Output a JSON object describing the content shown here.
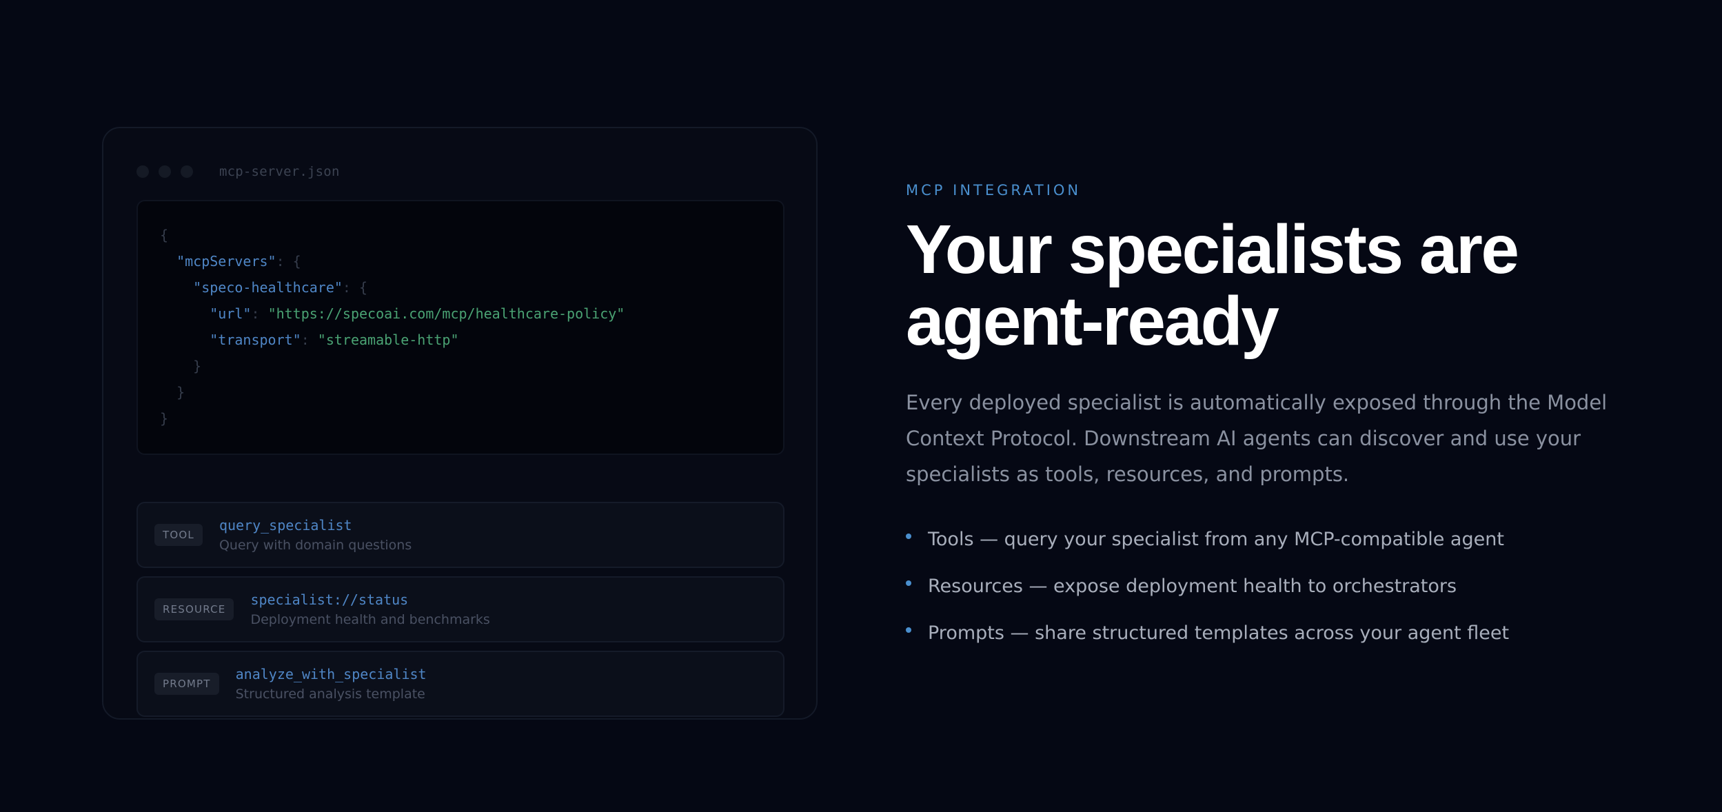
{
  "code_panel": {
    "filename": "mcp-server.json",
    "lines": [
      {
        "p0": "{",
        "k": "",
        "p1": "",
        "v": "",
        "p2": ""
      },
      {
        "p0": "  ",
        "k": "\"mcpServers\"",
        "p1": ": {",
        "v": "",
        "p2": ""
      },
      {
        "p0": "    ",
        "k": "\"speco-healthcare\"",
        "p1": ": {",
        "v": "",
        "p2": ""
      },
      {
        "p0": "      ",
        "k": "\"url\"",
        "p1": ": ",
        "v": "\"https://specoai.com/mcp/healthcare-policy\"",
        "p2": ""
      },
      {
        "p0": "      ",
        "k": "\"transport\"",
        "p1": ": ",
        "v": "\"streamable-http\"",
        "p2": ""
      },
      {
        "p0": "    }",
        "k": "",
        "p1": "",
        "v": "",
        "p2": ""
      },
      {
        "p0": "  }",
        "k": "",
        "p1": "",
        "v": "",
        "p2": ""
      },
      {
        "p0": "}",
        "k": "",
        "p1": "",
        "v": "",
        "p2": ""
      }
    ]
  },
  "items": [
    {
      "badge": "TOOL",
      "name": "query_specialist",
      "desc": "Query with domain questions"
    },
    {
      "badge": "RESOURCE",
      "name": "specialist://status",
      "desc": "Deployment health and benchmarks"
    },
    {
      "badge": "PROMPT",
      "name": "analyze_with_specialist",
      "desc": "Structured analysis template"
    }
  ],
  "content": {
    "eyebrow": "MCP INTEGRATION",
    "headline_1": "Your specialists are",
    "headline_2": "agent-ready",
    "description": "Every deployed specialist is automatically exposed through the Model Context Protocol. Downstream AI agents can discover and use your specialists as tools, resources, and prompts.",
    "bullets": [
      "Tools — query your specialist from any MCP-compatible agent",
      "Resources — expose deployment health to orchestrators",
      "Prompts — share structured templates across your agent fleet"
    ]
  },
  "colors": {
    "background": "#050814",
    "accent": "#4a8fce",
    "code_key": "#4f86c6",
    "code_string": "#4aa273"
  }
}
